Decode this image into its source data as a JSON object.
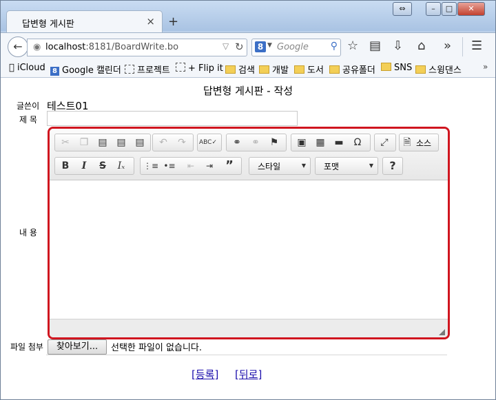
{
  "browser": {
    "tab_title": "답변형 게시판",
    "tab_close": "×",
    "new_tab": "+",
    "window_controls": {
      "restore": "⇔",
      "minimize": "–",
      "maximize": "□",
      "close": "✕"
    },
    "url_host": "localhost",
    "url_rest": ":8181/BoardWrite.bo",
    "search_placeholder": "Google",
    "search_engine_letter": "8",
    "icons": [
      "back-icon",
      "globe-icon",
      "reload-icon",
      "search-icon",
      "star-icon",
      "reading-list-icon",
      "download-icon",
      "home-icon",
      "overflow-icon",
      "menu-icon"
    ]
  },
  "bookmarks": {
    "items": [
      {
        "label": "iCloud",
        "icon": "apple-icon"
      },
      {
        "label": "Google 캘린더",
        "icon": "google-icon"
      },
      {
        "label": "프로젝트",
        "icon": "dashed-folder-icon"
      },
      {
        "label": "+ Flip it",
        "icon": "dashed-folder-icon"
      },
      {
        "label": "검색",
        "icon": "folder-icon"
      },
      {
        "label": "개발",
        "icon": "folder-icon"
      },
      {
        "label": "도서",
        "icon": "folder-icon"
      },
      {
        "label": "공유폴더",
        "icon": "folder-icon"
      },
      {
        "label": "SNS",
        "icon": "folder-icon"
      },
      {
        "label": "스윙댄스",
        "icon": "folder-icon"
      }
    ],
    "more": "»"
  },
  "page": {
    "title": "답변형 게시판 - 작성",
    "writer_label": "글쓴이",
    "writer_value": "테스트01",
    "subject_label": "제 목",
    "subject_value": "",
    "content_label": "내 용",
    "file_label": "파일 첨부",
    "file_button": "찾아보기...",
    "file_status": "선택한 파일이 없습니다.",
    "submit_link": "[등록]",
    "back_link": "[뒤로]"
  },
  "editor": {
    "source_label": "소스",
    "style_combo": "스타일",
    "format_combo": "포맷",
    "help_label": "?",
    "accent_color": "#d0151f"
  }
}
